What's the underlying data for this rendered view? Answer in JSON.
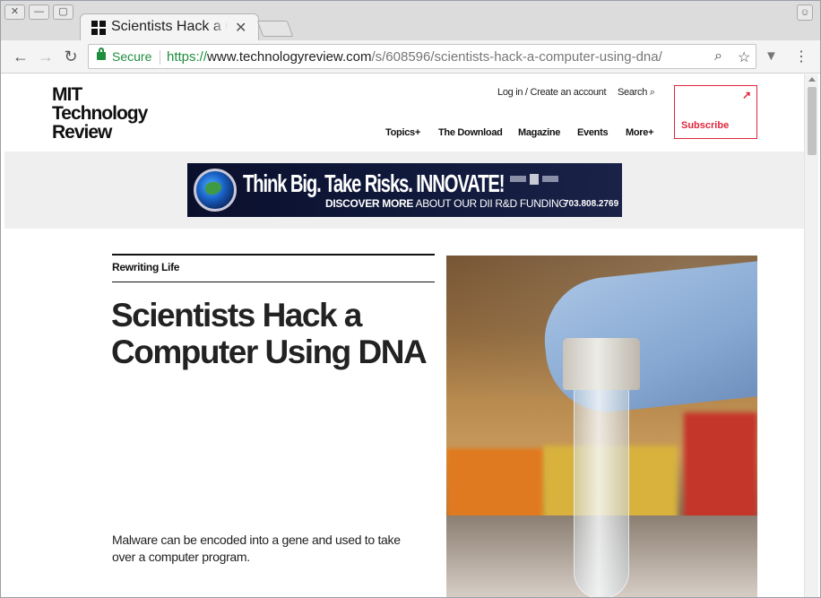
{
  "browser": {
    "tab_title": "Scientists Hack a Computer Using DNA",
    "tab_close": "✕",
    "secure_label": "Secure",
    "url_scheme": "https://",
    "url_host": "www.technologyreview.com",
    "url_path": "/s/608596/scientists-hack-a-computer-using-dna/"
  },
  "site": {
    "logo_lines": [
      "MIT",
      "Technology",
      "Review"
    ],
    "login": "Log in / Create an account",
    "search": "Search",
    "subscribe": "Subscribe",
    "nav": [
      "Topics+",
      "The Download",
      "Magazine",
      "Events",
      "More+"
    ],
    "accent_color": "#e0263c"
  },
  "ad": {
    "headline": "Think Big. Take Risks. INNOVATE!",
    "sub_bold": "DISCOVER MORE",
    "sub_rest": "ABOUT OUR DII R&D FUNDING",
    "phone": "703.808.2769"
  },
  "article": {
    "kicker": "Rewriting Life",
    "headline": "Scientists Hack a Computer Using DNA",
    "dek": "Malware can be encoded into a gene and used to take over a computer program."
  }
}
